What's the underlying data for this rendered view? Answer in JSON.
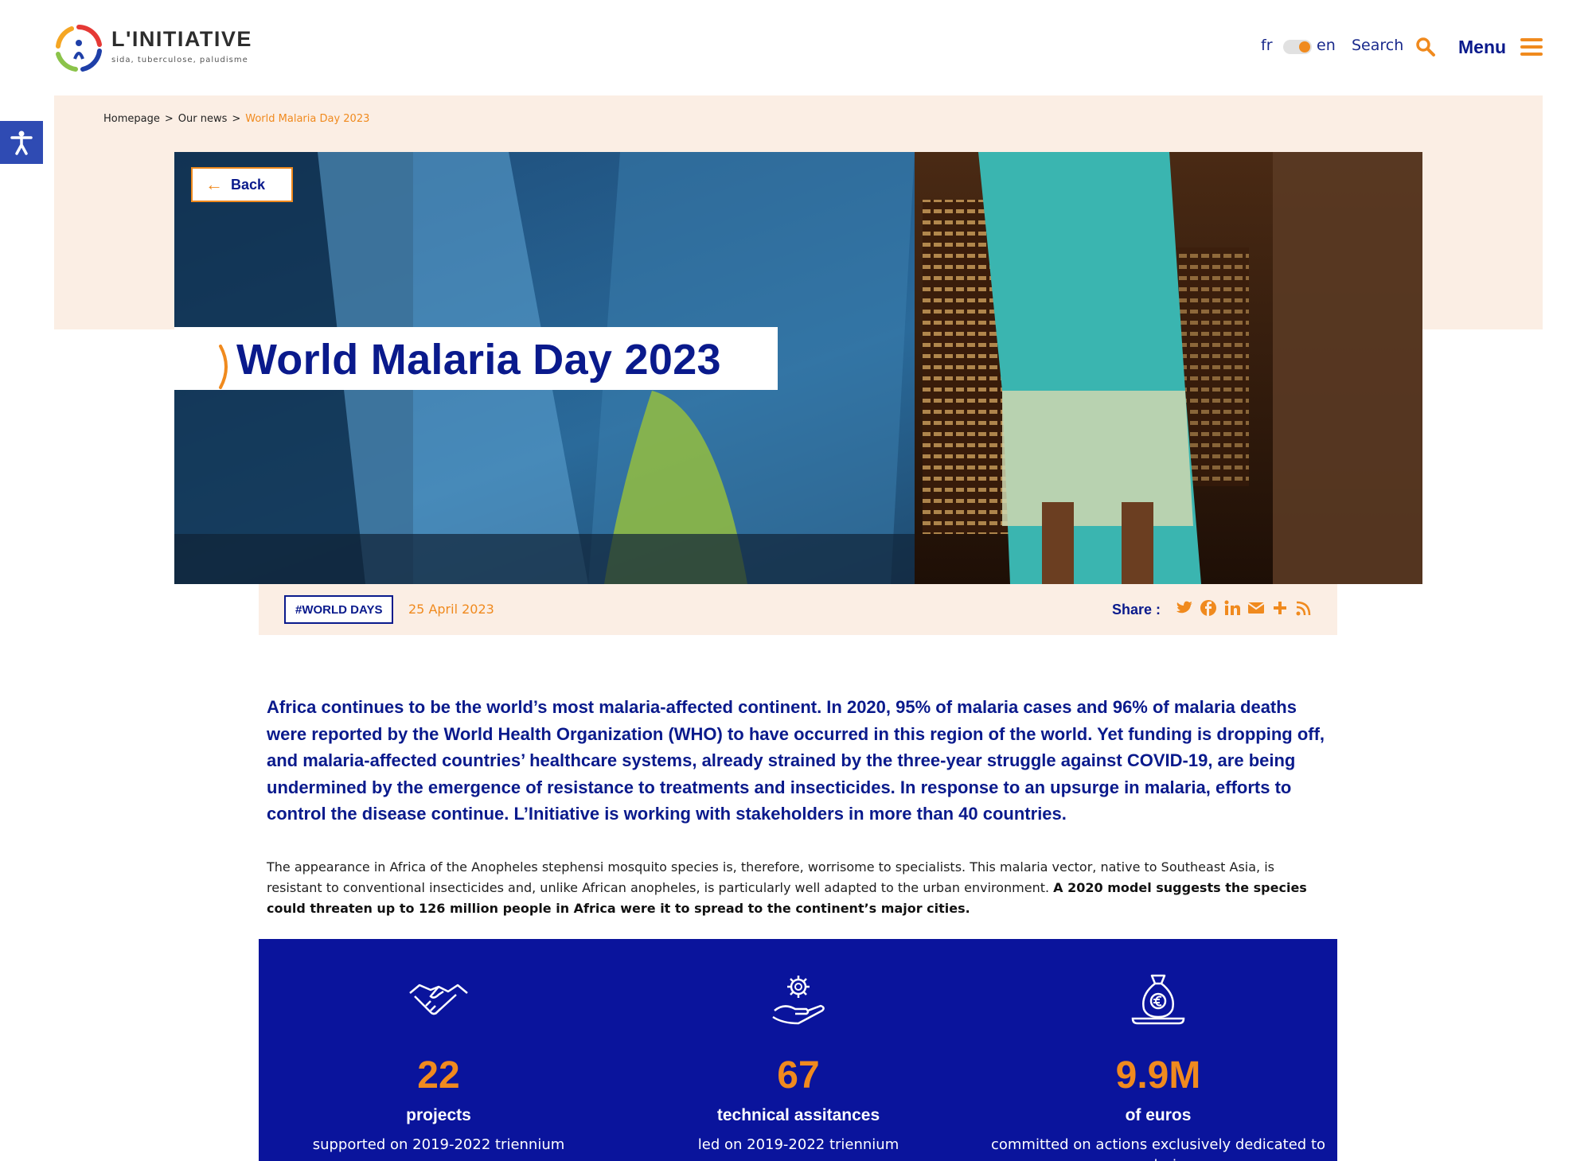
{
  "header": {
    "logo_title": "L'INITIATIVE",
    "logo_subtitle": "sida, tuberculose, paludisme",
    "lang_fr": "fr",
    "lang_en": "en",
    "search_label": "Search",
    "menu_label": "Menu"
  },
  "breadcrumb": {
    "items": [
      "Homepage",
      "Our news",
      "World Malaria Day 2023"
    ],
    "separator": ">"
  },
  "hero": {
    "back_label": "Back",
    "title": "World Malaria Day 2023"
  },
  "meta": {
    "tag": "#WORLD DAYS",
    "date": "25 April 2023",
    "share_label": "Share :",
    "share_icons": [
      "twitter-icon",
      "facebook-icon",
      "linkedin-icon",
      "email-icon",
      "plus-icon",
      "rss-icon"
    ]
  },
  "article": {
    "lead": "Africa continues to be the world’s most malaria-affected continent. In 2020, 95% of malaria cases and 96% of malaria deaths were reported by the World Health Organization (WHO) to have occurred in this region of the world. Yet funding is dropping off, and malaria-affected countries’ healthcare systems, already strained by the three-year struggle against COVID-19, are being undermined by the emergence of resistance to treatments and insecticides. In response to an upsurge in malaria, efforts to control the disease continue. L’Initiative is working with stakeholders in more than 40 countries.",
    "para_text": "The appearance in Africa of the Anopheles stephensi mosquito species is, therefore, worrisome to specialists. This malaria vector, native to Southeast Asia, is resistant to conventional insecticides and, unlike African anopheles, is particularly well adapted to the urban environment. ",
    "para_bold": "A 2020 model suggests the species could threaten up to 126 million people in Africa were it to spread to the continent’s major cities."
  },
  "stats": [
    {
      "icon": "handshake-icon",
      "number": "22",
      "unit": "projects",
      "desc": "supported on 2019-2022 triennium"
    },
    {
      "icon": "hand-gear-icon",
      "number": "67",
      "unit": "technical assitances",
      "desc": "led on 2019-2022 triennium"
    },
    {
      "icon": "money-bag-icon",
      "number": "9.9M",
      "unit": "of euros",
      "desc": "committed on actions exclusively dedicated to malaria"
    }
  ],
  "colors": {
    "navy": "#0a1a8c",
    "orange": "#f08a1e",
    "peach": "#fbeee4",
    "stats_bg": "#0a149c",
    "a11y_bg": "#2f4bb3"
  }
}
